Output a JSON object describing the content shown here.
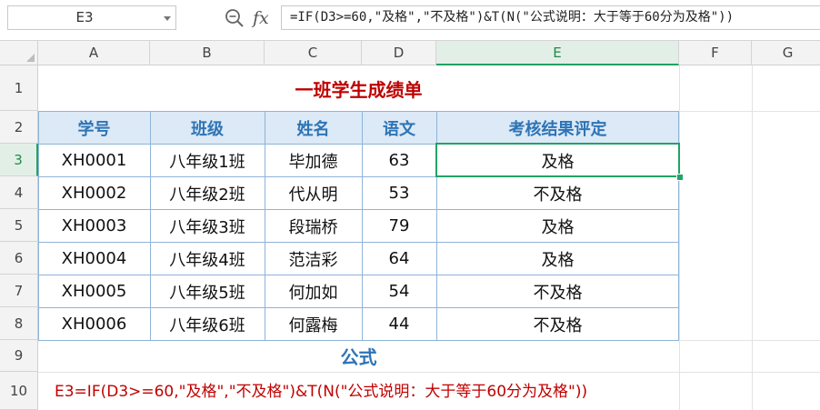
{
  "formula_bar": {
    "name_box": "E3",
    "formula": "=IF(D3>=60,\"及格\",\"不及格\")&T(N(\"公式说明：大于等于60分为及格\"))",
    "fx_label": "fx"
  },
  "columns": [
    "A",
    "B",
    "C",
    "D",
    "E",
    "F",
    "G"
  ],
  "rows": [
    "1",
    "2",
    "3",
    "4",
    "5",
    "6",
    "7",
    "8",
    "9",
    "10"
  ],
  "sheet": {
    "title": "一班学生成绩单",
    "headers": [
      "学号",
      "班级",
      "姓名",
      "语文",
      "考核结果评定"
    ],
    "records": [
      [
        "XH0001",
        "八年级1班",
        "毕加德",
        "63",
        "及格"
      ],
      [
        "XH0002",
        "八年级2班",
        "代从明",
        "53",
        "不及格"
      ],
      [
        "XH0003",
        "八年级3班",
        "段瑞桥",
        "79",
        "及格"
      ],
      [
        "XH0004",
        "八年级4班",
        "范洁彩",
        "64",
        "及格"
      ],
      [
        "XH0005",
        "八年级5班",
        "何加如",
        "54",
        "不及格"
      ],
      [
        "XH0006",
        "八年级6班",
        "何露梅",
        "44",
        "不及格"
      ]
    ],
    "formula_heading": "公式",
    "formula_note": "E3=IF(D3>=60,\"及格\",\"不及格\")&T(N(\"公式说明：大于等于60分为及格\"))"
  },
  "selection": {
    "cell": "E3",
    "accent": "#21a366"
  },
  "colors": {
    "title": "#c00000",
    "header_text": "#2e74b5",
    "header_fill": "#dce9f6",
    "table_border": "#8fb4d9"
  }
}
